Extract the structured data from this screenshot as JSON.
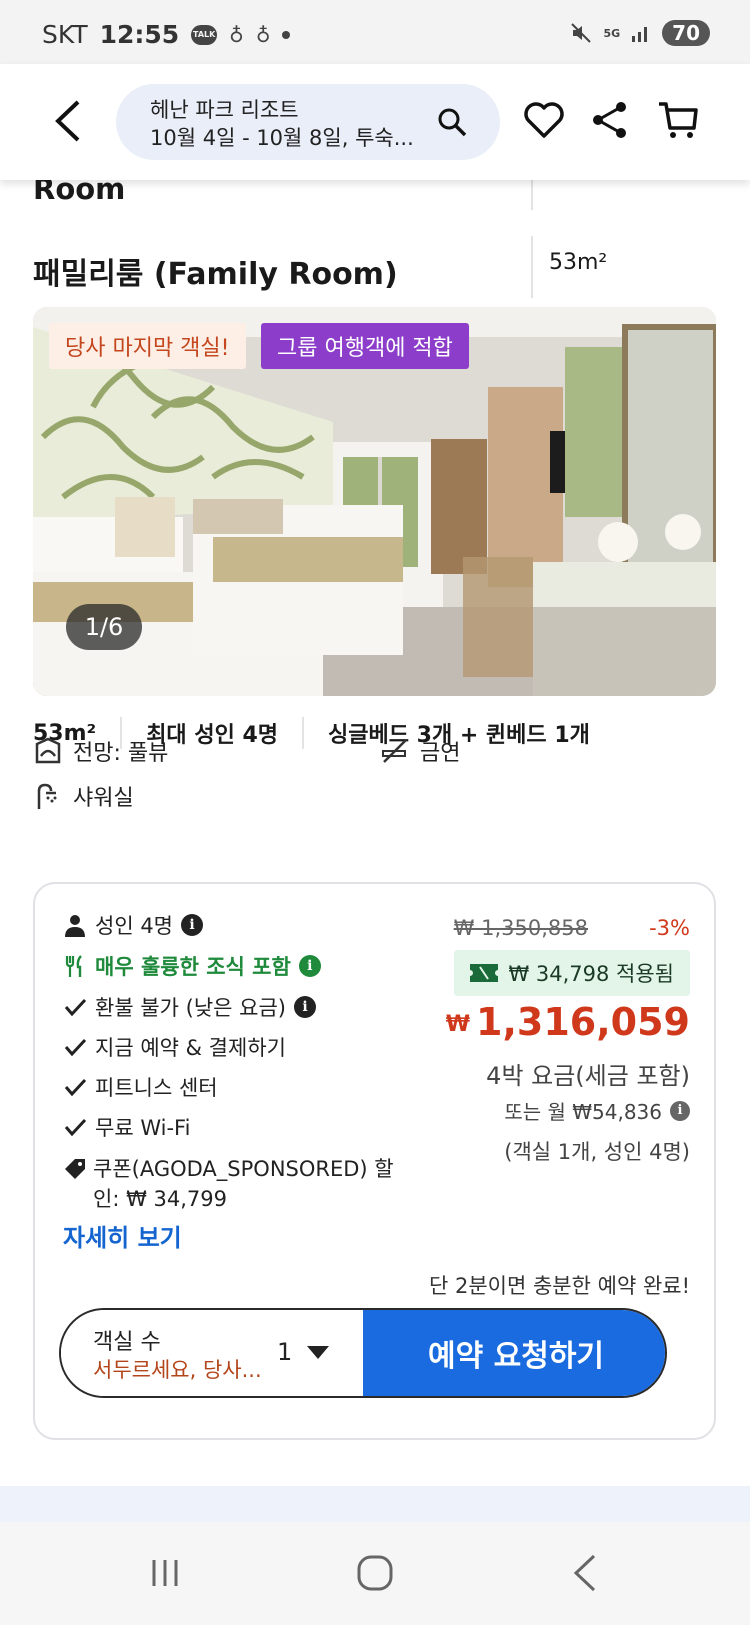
{
  "status_bar": {
    "carrier": "SKT",
    "time": "12:55",
    "talk": "TALK",
    "network": "5G",
    "battery": "70"
  },
  "header": {
    "hotel_name": "헤난 파크 리조트",
    "dates": "10월 4일 - 10월 8일, 투숙..."
  },
  "room": {
    "prev_name_tail": "Room",
    "name": "패밀리룸 (Family Room)",
    "size": "53m²",
    "badges": {
      "last_room": "당사 마지막 객실!",
      "group": "그룹 여행객에 적합"
    },
    "photo_counter": "1/6",
    "specs": [
      "53m²",
      "최대 성인 4명",
      "싱글베드 3개 + 퀸베드 1개"
    ],
    "features": {
      "view": "전망: 풀뷰",
      "non_smoking": "금연",
      "shower": "샤워실"
    }
  },
  "offer": {
    "adults": "성인 4명",
    "breakfast": "매우 훌륭한 조식 포함",
    "non_refundable": "환불 불가 (낮은 요금)",
    "pay_now": "지금 예약 & 결제하기",
    "fitness": "피트니스 센터",
    "wifi": "무료 Wi-Fi",
    "coupon_line1": "쿠폰(AGODA_SPONSORED) 할",
    "coupon_line2": "인: ₩ 34,799",
    "details_link": "자세히 보기",
    "original_price": "₩ 1,350,858",
    "discount": "-3%",
    "coupon_applied": "₩ 34,798 적용됨",
    "currency": "₩",
    "price": "1,316,059",
    "price_note": "4박 요금(세금 포함)",
    "monthly": "또는 월 ₩54,836",
    "occupancy": "(객실 1개, 성인 4명)",
    "quick_note": "단 2분이면 충분한 예약 완료!",
    "rooms_label": "객실 수",
    "rooms_hint": "서두르세요, 당사...",
    "rooms_count": "1",
    "book_button": "예약 요청하기"
  },
  "colors": {
    "accent_blue": "#1a6be0",
    "price_red": "#d0381c",
    "breakfast_green": "#1f8a3b",
    "group_purple": "#8c3dc9"
  }
}
